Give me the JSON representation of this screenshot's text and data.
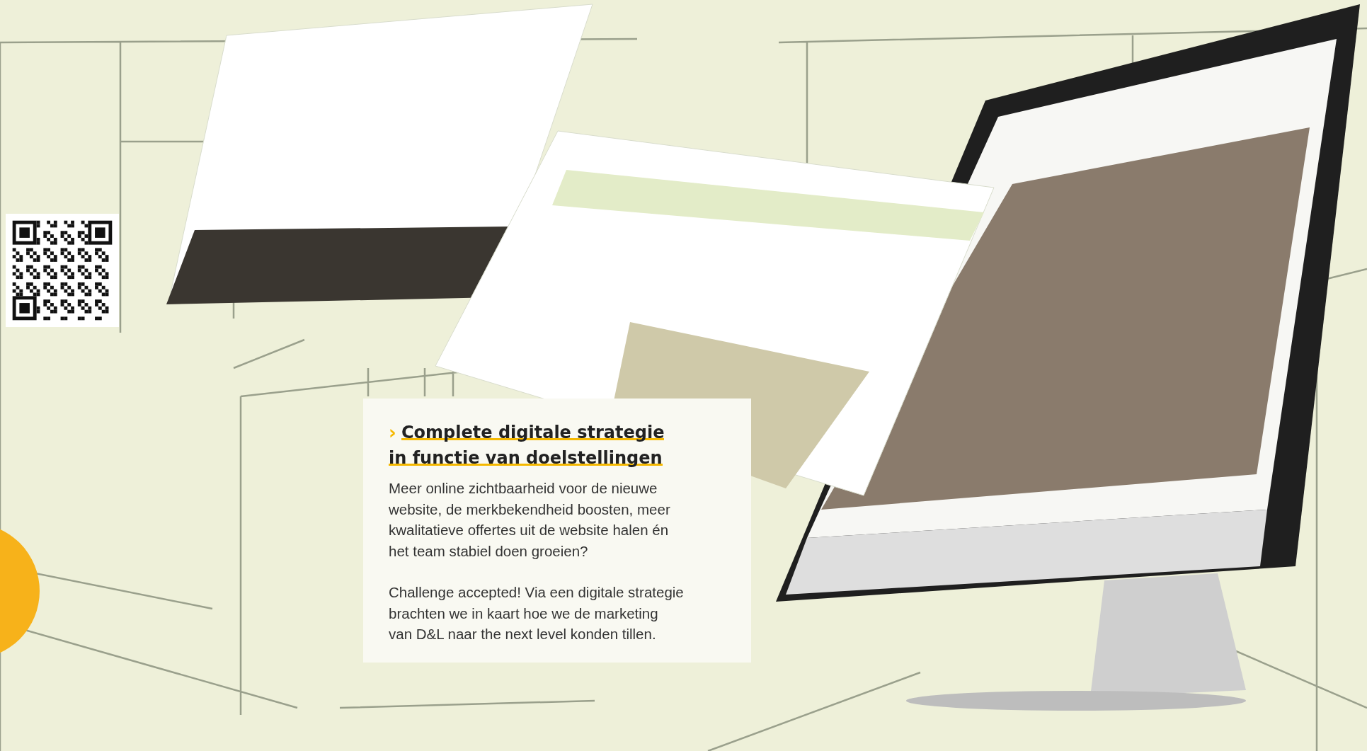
{
  "card": {
    "marker": "›",
    "heading": "Complete digitale strategie\nin functie van doelstellingen",
    "paragraphs": [
      "Meer online zichtbaarheid voor de nieuwe\nwebsite, de merkbekendheid boosten, meer\nkwalitatieve offertes uit de website halen én\nhet team stabiel doen groeien?",
      "Challenge accepted! Via een digitale strategie\nbrachten we in kaart hoe we de marketing\nvan D&L naar the next level konden tillen."
    ]
  }
}
